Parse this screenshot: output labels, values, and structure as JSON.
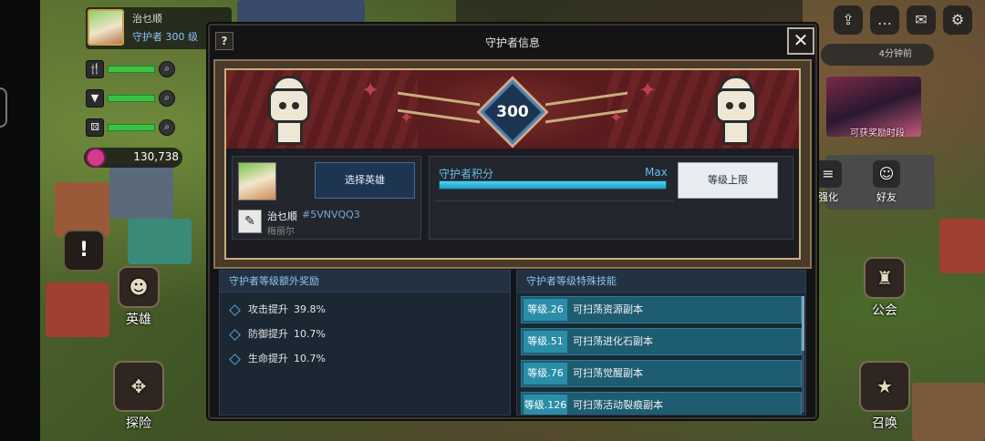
{
  "player": {
    "name": "治乜顺",
    "level_text": "守护者 300 级"
  },
  "resources": {
    "gems": "130,738"
  },
  "top_bar": {
    "timer": "4分钟前"
  },
  "event": {
    "label": "可获奖励时段"
  },
  "left_menu": {
    "hero_label": "英雄",
    "explore_label": "探险",
    "alert": "!"
  },
  "right_menu": {
    "guild_label": "公会",
    "summon_label": "召唤",
    "friend_label": "好友",
    "other_label": "强化"
  },
  "modal": {
    "help": "?",
    "title": "守护者信息",
    "close": "✕",
    "guardian_level": "300",
    "hero": {
      "name": "治乜顺",
      "code": "#5VNVQQ3",
      "subtitle": "梅丽尔",
      "select_button": "选择英雄"
    },
    "score": {
      "label": "守护者积分",
      "max_label": "Max",
      "progress": 1.0,
      "cap_button": "等级上限"
    },
    "bonus": {
      "title": "守护者等级额外奖励",
      "items": [
        {
          "label": "攻击提升",
          "value": "39.8%"
        },
        {
          "label": "防御提升",
          "value": "10.7%"
        },
        {
          "label": "生命提升",
          "value": "10.7%"
        }
      ]
    },
    "skills": {
      "title": "守护者等级特殊技能",
      "items": [
        {
          "level": "等级.26",
          "text": "可扫荡资源副本"
        },
        {
          "level": "等级.51",
          "text": "可扫荡进化石副本"
        },
        {
          "level": "等级.76",
          "text": "可扫荡觉醒副本"
        },
        {
          "level": "等级.126",
          "text": "可扫荡活动裂痕副本"
        }
      ]
    }
  },
  "colors": {
    "accent": "#5ec0ea",
    "banner_red": "#6b2325",
    "frame_gold": "#c8ae7c"
  }
}
